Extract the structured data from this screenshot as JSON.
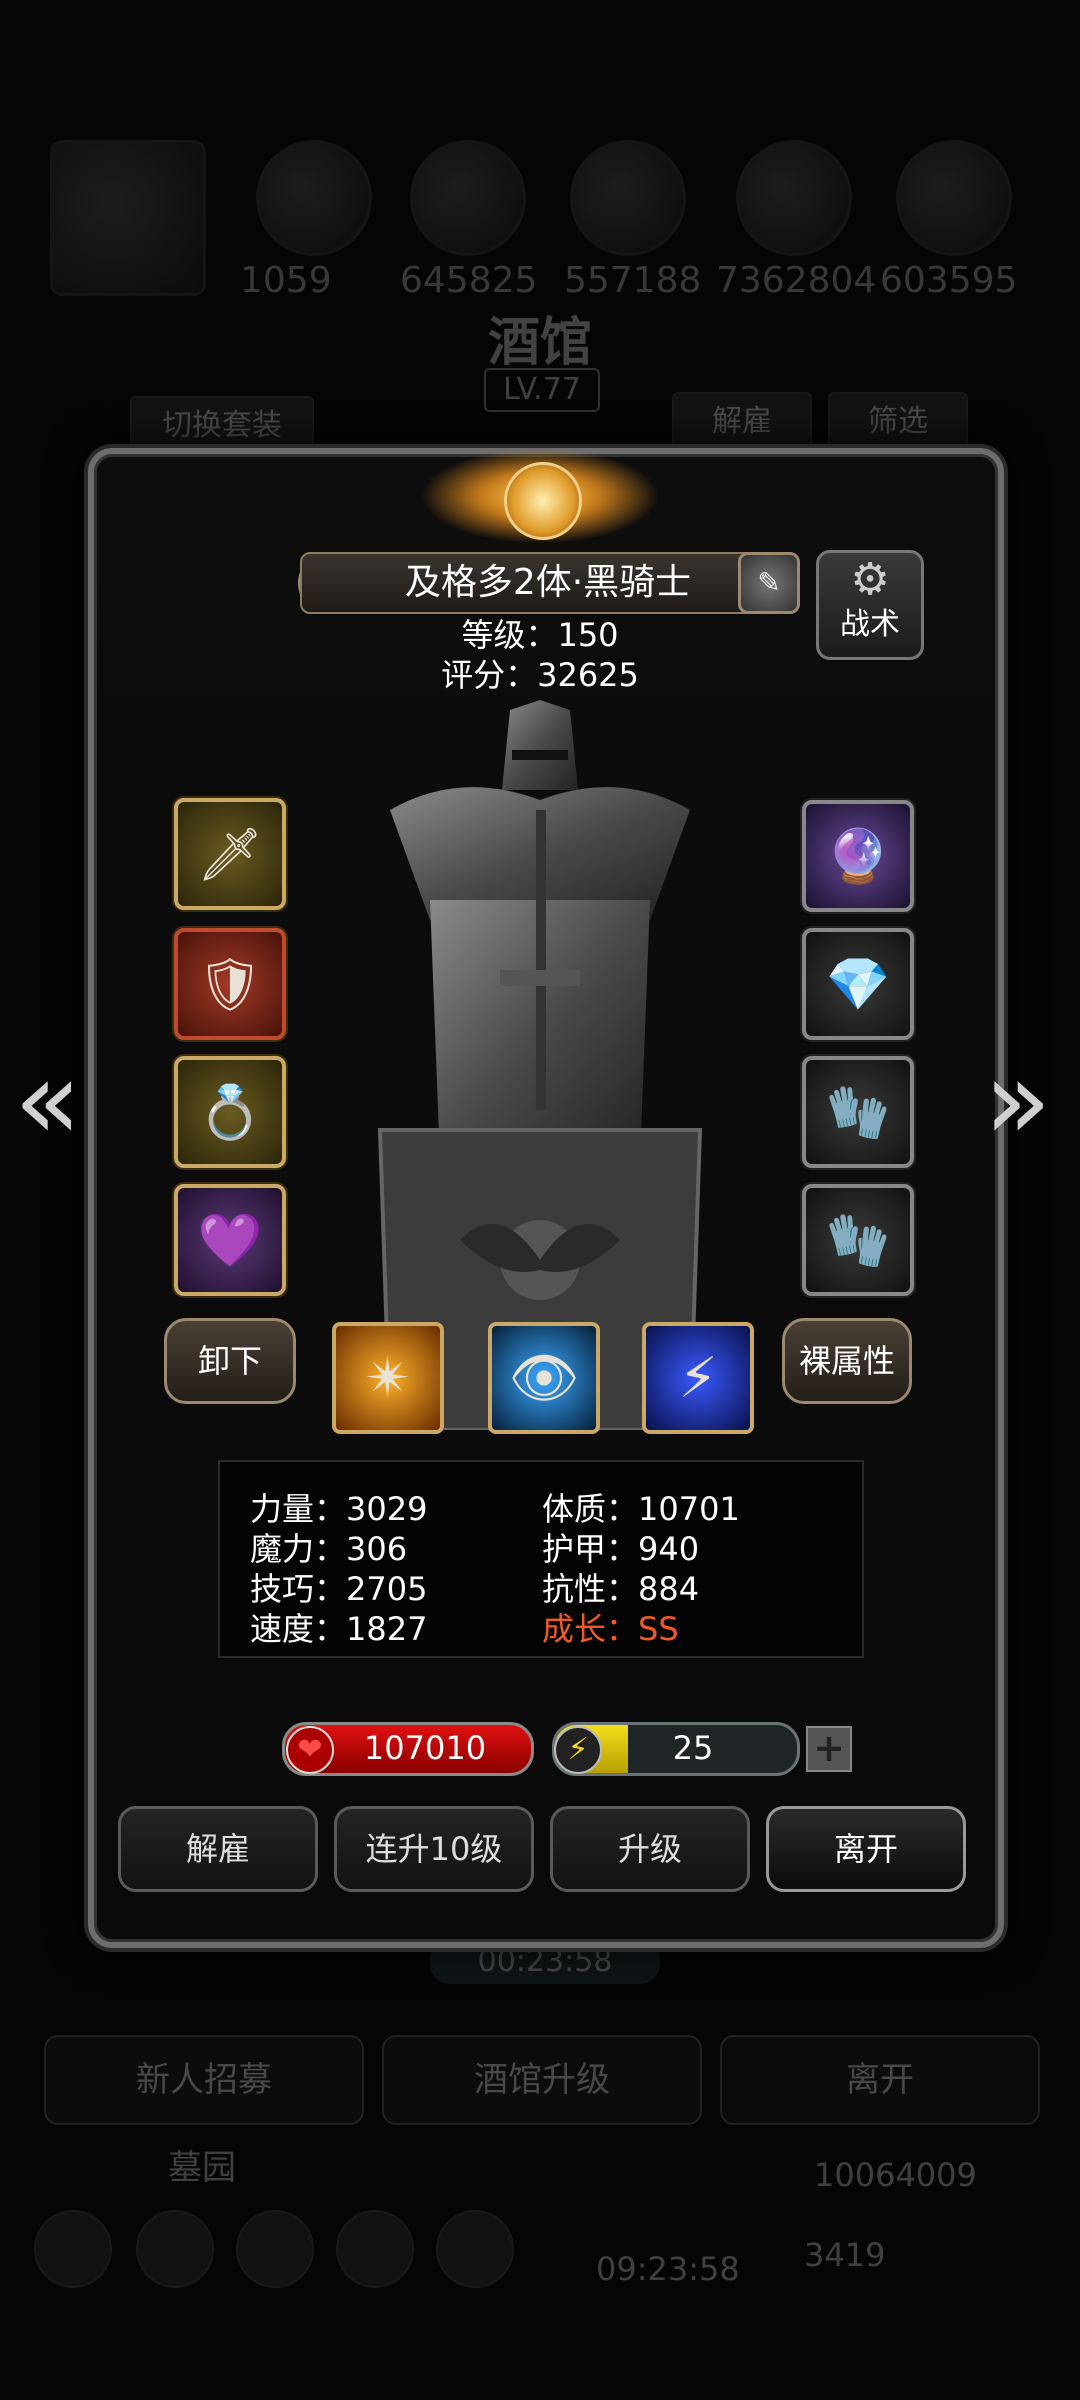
{
  "background": {
    "resources": [
      "1059",
      "645825",
      "557188",
      "7362804",
      "603595"
    ],
    "title": "酒馆",
    "level": "LV.77",
    "switch_outfit": "切换套装",
    "dismiss": "解雇",
    "filter": "筛选",
    "timer": "00:23:58",
    "bottom_buttons": [
      "新人招募",
      "酒馆升级",
      "离开"
    ],
    "cemetery": "墓园",
    "gold": "10064009",
    "gems": "3419",
    "clock": "09:23:58"
  },
  "hero": {
    "name": "及格多2体·黑骑士",
    "level_text": "等级：150",
    "score_text": "评分：32625",
    "tactics_label": "战术"
  },
  "equipment": {
    "left": [
      "spear-icon",
      "armor-icon",
      "emerald-ring-icon",
      "purple-ring-icon"
    ],
    "right": [
      "dark-amulet-icon",
      "crystal-shard-icon",
      "gauntlet-icon",
      "gauntlet-icon"
    ]
  },
  "buttons": {
    "unequip": "卸下",
    "base_attr": "裸属性"
  },
  "skills": [
    "golden-shield-skill-icon",
    "blue-eye-skill-icon",
    "lightning-slash-skill-icon"
  ],
  "stats": {
    "strength": "力量：3029",
    "magic": "魔力：306",
    "skill": "技巧：2705",
    "speed": "速度：1827",
    "constitution": "体质：10701",
    "armor": "护甲：940",
    "resistance": "抗性：884",
    "growth": "成长：SS"
  },
  "hp": "107010",
  "energy": {
    "value": "25",
    "fill_fraction": 0.3
  },
  "actions": [
    "解雇",
    "连升10级",
    "升级",
    "离开"
  ],
  "colors": {
    "gold_border": "#caa866",
    "hp_red": "#e01010",
    "energy_yellow": "#f2de1a",
    "growth": "#f05a2a"
  }
}
